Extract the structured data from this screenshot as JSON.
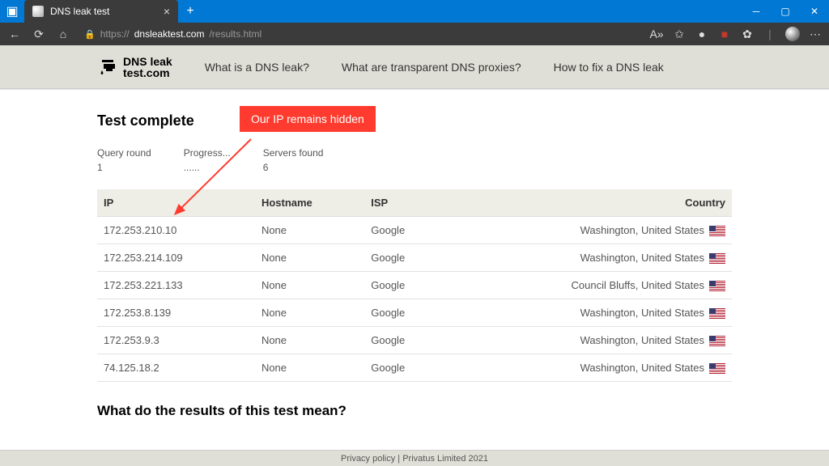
{
  "browser": {
    "tab_title": "DNS leak test",
    "url_prefix": "https://",
    "url_host": "dnsleaktest.com",
    "url_path": "/results.html"
  },
  "logo_line1": "DNS leak",
  "logo_line2": "test.com",
  "nav": [
    "What is a DNS leak?",
    "What are transparent DNS proxies?",
    "How to fix a DNS leak"
  ],
  "heading": "Test complete",
  "callout": "Our IP remains hidden",
  "stats": {
    "query_round_label": "Query round",
    "query_round_value": "1",
    "progress_label": "Progress...",
    "progress_value": "......",
    "servers_label": "Servers found",
    "servers_value": "6"
  },
  "columns": [
    "IP",
    "Hostname",
    "ISP",
    "Country"
  ],
  "rows": [
    {
      "ip": "172.253.210.10",
      "hostname": "None",
      "isp": "Google",
      "country": "Washington, United States"
    },
    {
      "ip": "172.253.214.109",
      "hostname": "None",
      "isp": "Google",
      "country": "Washington, United States"
    },
    {
      "ip": "172.253.221.133",
      "hostname": "None",
      "isp": "Google",
      "country": "Council Bluffs, United States"
    },
    {
      "ip": "172.253.8.139",
      "hostname": "None",
      "isp": "Google",
      "country": "Washington, United States"
    },
    {
      "ip": "172.253.9.3",
      "hostname": "None",
      "isp": "Google",
      "country": "Washington, United States"
    },
    {
      "ip": "74.125.18.2",
      "hostname": "None",
      "isp": "Google",
      "country": "Washington, United States"
    }
  ],
  "subheading": "What do the results of this test mean?",
  "footer_link": "Privacy policy",
  "footer_rest": " | Privatus Limited 2021"
}
